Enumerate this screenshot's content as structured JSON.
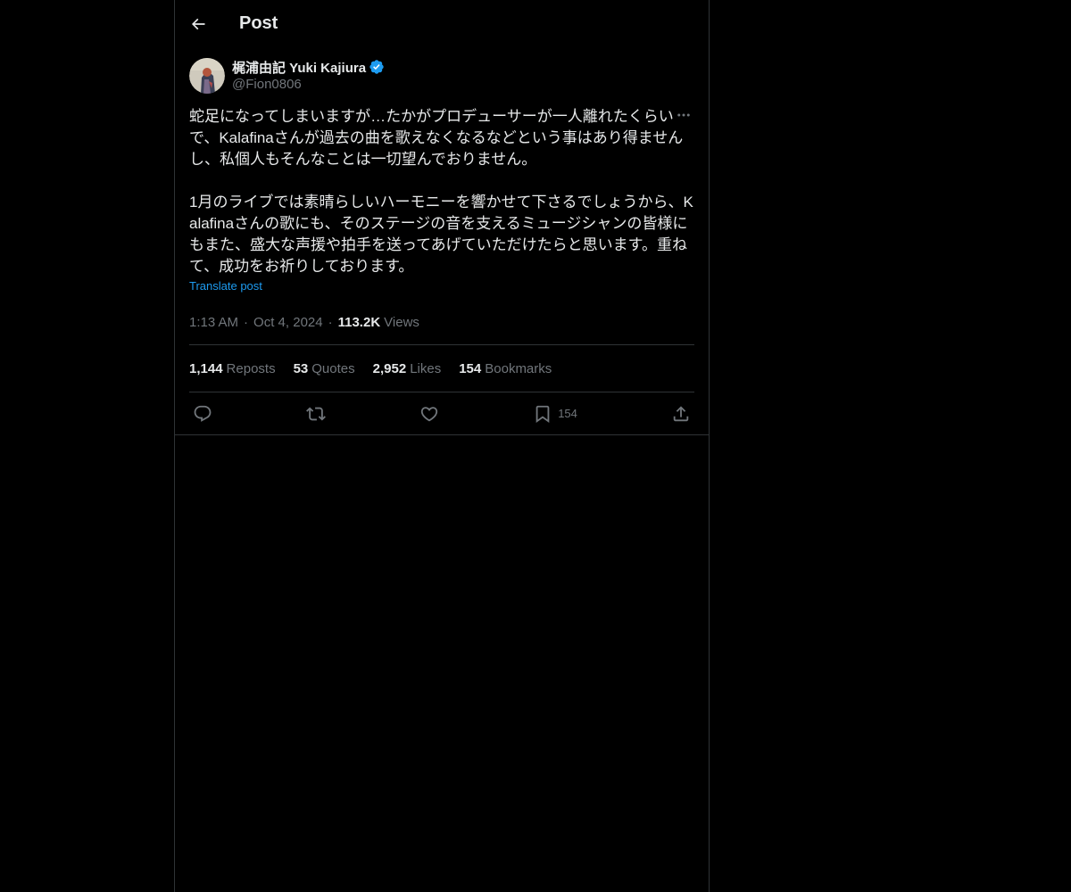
{
  "header": {
    "title": "Post",
    "back_icon": "arrow-left-icon"
  },
  "author": {
    "display_name": "梶浦由記 Yuki Kajiura",
    "handle": "@Fion0806",
    "verified_color": "#1d9bf0"
  },
  "post": {
    "body": "蛇足になってしまいますが…たかがプロデューサーが一人離れたくらいで、Kalafinaさんが過去の曲を歌えなくなるなどという事はあり得ませんし、私個人もそんなことは一切望んでおりません。\n\n1月のライブでは素晴らしいハーモニーを響かせて下さるでしょうから、Kalafinaさんの歌にも、そのステージの音を支えるミュージシャンの皆様にもまた、盛大な声援や拍手を送ってあげていただけたらと思います。重ねて、成功をお祈りしております。",
    "translate_label": "Translate post",
    "time": "1:13 AM",
    "date": "Oct 4, 2024",
    "views_count": "113.2K",
    "views_label": "Views"
  },
  "stats": {
    "reposts_count": "1,144",
    "reposts_label": "Reposts",
    "quotes_count": "53",
    "quotes_label": "Quotes",
    "likes_count": "2,952",
    "likes_label": "Likes",
    "bookmarks_count": "154",
    "bookmarks_label": "Bookmarks"
  },
  "actions": {
    "reply_icon": "reply-icon",
    "repost_icon": "repost-icon",
    "like_icon": "heart-icon",
    "bookmark_icon": "bookmark-icon",
    "bookmark_count": "154",
    "share_icon": "share-icon"
  },
  "colors": {
    "background": "#000000",
    "text": "#e7e9ea",
    "muted": "#71767b",
    "accent": "#1d9bf0",
    "border": "#2f3336"
  }
}
